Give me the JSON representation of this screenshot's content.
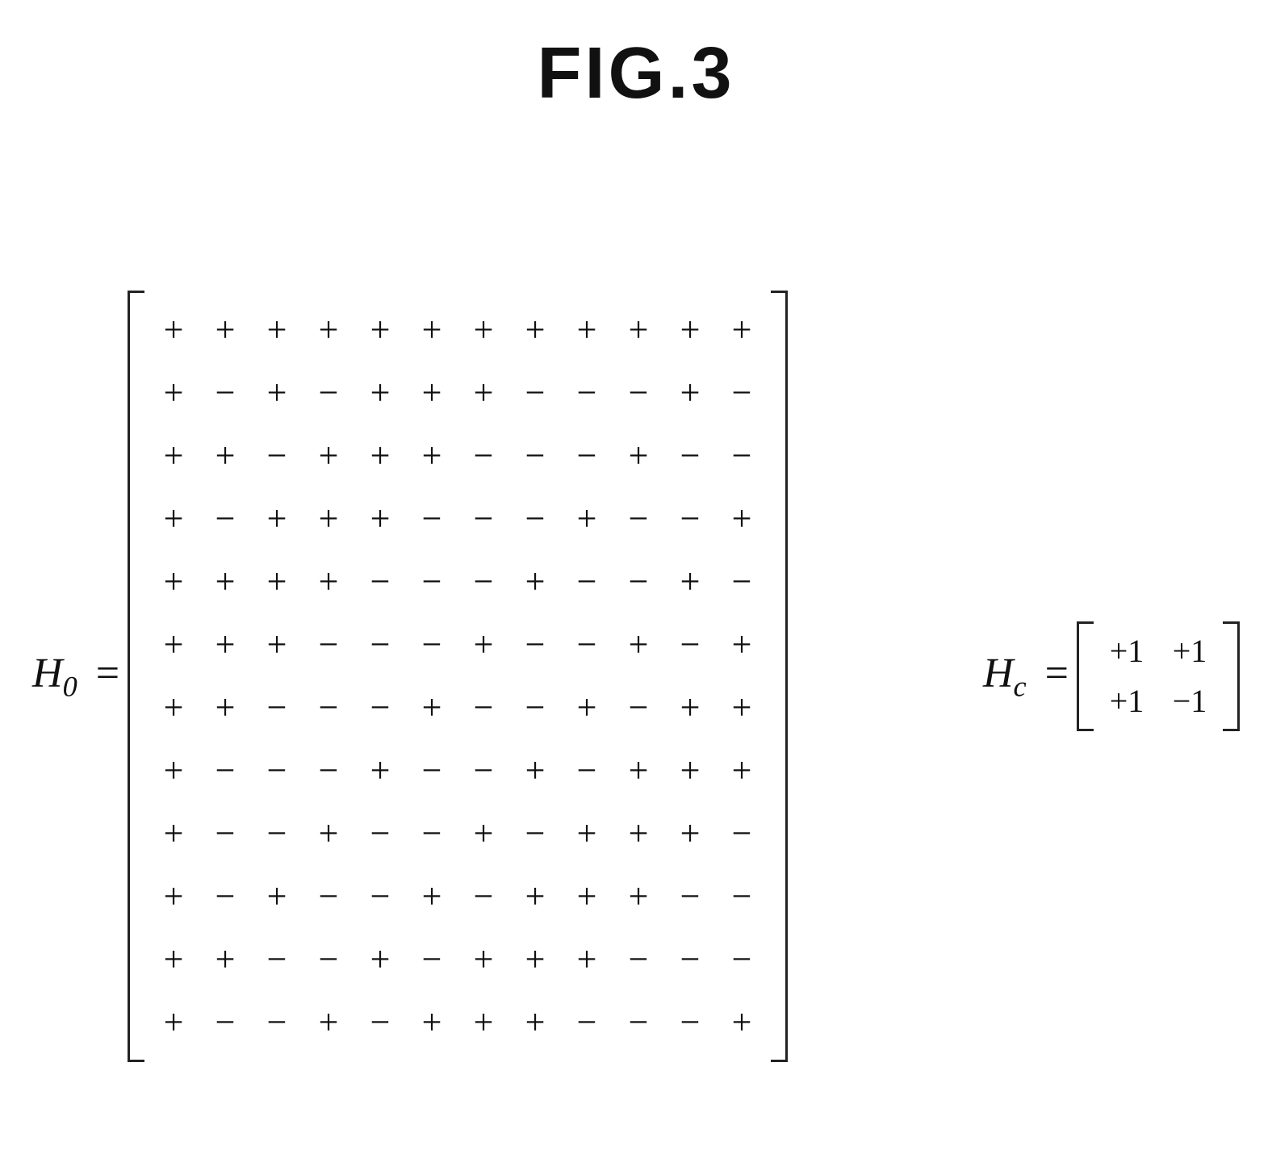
{
  "title": "FIG.3",
  "H0_label_base": "H",
  "H0_label_sub": "0",
  "Hc_label_base": "H",
  "Hc_label_sub": "c",
  "eq": "=",
  "H0_matrix": [
    [
      "+",
      "+",
      "+",
      "+",
      "+",
      "+",
      "+",
      "+",
      "+",
      "+",
      "+",
      "+"
    ],
    [
      "+",
      "−",
      "+",
      "−",
      "+",
      "+",
      "+",
      "−",
      "−",
      "−",
      "+",
      "−"
    ],
    [
      "+",
      "+",
      "−",
      "+",
      "+",
      "+",
      "−",
      "−",
      "−",
      "+",
      "−",
      "−"
    ],
    [
      "+",
      "−",
      "+",
      "+",
      "+",
      "−",
      "−",
      "−",
      "+",
      "−",
      "−",
      "+"
    ],
    [
      "+",
      "+",
      "+",
      "+",
      "−",
      "−",
      "−",
      "+",
      "−",
      "−",
      "+",
      "−"
    ],
    [
      "+",
      "+",
      "+",
      "−",
      "−",
      "−",
      "+",
      "−",
      "−",
      "+",
      "−",
      "+"
    ],
    [
      "+",
      "+",
      "−",
      "−",
      "−",
      "+",
      "−",
      "−",
      "+",
      "−",
      "+",
      "+"
    ],
    [
      "+",
      "−",
      "−",
      "−",
      "+",
      "−",
      "−",
      "+",
      "−",
      "+",
      "+",
      "+"
    ],
    [
      "+",
      "−",
      "−",
      "+",
      "−",
      "−",
      "+",
      "−",
      "+",
      "+",
      "+",
      "−"
    ],
    [
      "+",
      "−",
      "+",
      "−",
      "−",
      "+",
      "−",
      "+",
      "+",
      "+",
      "−",
      "−"
    ],
    [
      "+",
      "+",
      "−",
      "−",
      "+",
      "−",
      "+",
      "+",
      "+",
      "−",
      "−",
      "−"
    ],
    [
      "+",
      "−",
      "−",
      "+",
      "−",
      "+",
      "+",
      "+",
      "−",
      "−",
      "−",
      "+"
    ]
  ],
  "Hc_matrix": [
    [
      "+1",
      "+1"
    ],
    [
      "+1",
      "−1"
    ]
  ],
  "chart_data": {
    "type": "table",
    "title": "FIG.3",
    "matrices": [
      {
        "name": "H0",
        "rows": 12,
        "cols": 12,
        "legend": {
          "+": 1,
          "−": -1
        },
        "values": [
          [
            1,
            1,
            1,
            1,
            1,
            1,
            1,
            1,
            1,
            1,
            1,
            1
          ],
          [
            1,
            -1,
            1,
            -1,
            1,
            1,
            1,
            -1,
            -1,
            -1,
            1,
            -1
          ],
          [
            1,
            1,
            -1,
            1,
            1,
            1,
            -1,
            -1,
            -1,
            1,
            -1,
            -1
          ],
          [
            1,
            -1,
            1,
            1,
            1,
            -1,
            -1,
            -1,
            1,
            -1,
            -1,
            1
          ],
          [
            1,
            1,
            1,
            1,
            -1,
            -1,
            -1,
            1,
            -1,
            -1,
            1,
            -1
          ],
          [
            1,
            1,
            1,
            -1,
            -1,
            -1,
            1,
            -1,
            -1,
            1,
            -1,
            1
          ],
          [
            1,
            1,
            -1,
            -1,
            -1,
            1,
            -1,
            -1,
            1,
            -1,
            1,
            1
          ],
          [
            1,
            -1,
            -1,
            -1,
            1,
            -1,
            -1,
            1,
            -1,
            1,
            1,
            1
          ],
          [
            1,
            -1,
            -1,
            1,
            -1,
            -1,
            1,
            -1,
            1,
            1,
            1,
            -1
          ],
          [
            1,
            -1,
            1,
            -1,
            -1,
            1,
            -1,
            1,
            1,
            1,
            -1,
            -1
          ],
          [
            1,
            1,
            -1,
            -1,
            1,
            -1,
            1,
            1,
            1,
            -1,
            -1,
            -1
          ],
          [
            1,
            -1,
            -1,
            1,
            -1,
            1,
            1,
            1,
            -1,
            -1,
            -1,
            1
          ]
        ]
      },
      {
        "name": "Hc",
        "rows": 2,
        "cols": 2,
        "values": [
          [
            1,
            1
          ],
          [
            1,
            -1
          ]
        ]
      }
    ]
  }
}
